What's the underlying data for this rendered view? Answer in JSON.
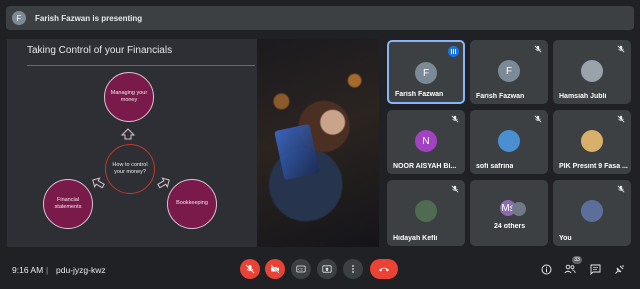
{
  "presenter_bar": {
    "avatar_letter": "F",
    "text": "Farish Fazwan is presenting"
  },
  "slide": {
    "title": "Taking Control of your Financials",
    "center": "How to control your money?",
    "top": "Managing your money",
    "left": "Financial statements",
    "right": "Bookkeeping"
  },
  "tiles": [
    {
      "name": "Farish Fazwan",
      "avatar": "F",
      "color": "#7b8a96",
      "active": true
    },
    {
      "name": "Farish Fazwan",
      "avatar": "F",
      "color": "#7b8a96"
    },
    {
      "name": "Hamsiah Jubli",
      "avatar": "",
      "color": "#9aa3ab"
    },
    {
      "name": "NOOR AISYAH BI...",
      "avatar": "N",
      "color": "#a142c3"
    },
    {
      "name": "sofi safrina",
      "avatar": "",
      "color": "#4a8fd1"
    },
    {
      "name": "PIK Presint 9 Fasa ...",
      "avatar": "",
      "color": "#d8b06a"
    },
    {
      "name": "Hidayah Kefli",
      "avatar": "",
      "color": "#4f6b52"
    },
    {
      "name": "24 others",
      "avatar": "Ms",
      "color": "#8e6bb0"
    },
    {
      "name": "You",
      "avatar": "",
      "color": "#5b6f9a"
    }
  ],
  "bottom": {
    "time": "9:16 AM",
    "separator": "|",
    "meeting_code": "pdu-jyzg-kwz",
    "participants_count": "33"
  },
  "colors": {
    "accent": "#8ab4f8",
    "danger": "#ea4335",
    "slide_circle": "#7a1a4a"
  }
}
